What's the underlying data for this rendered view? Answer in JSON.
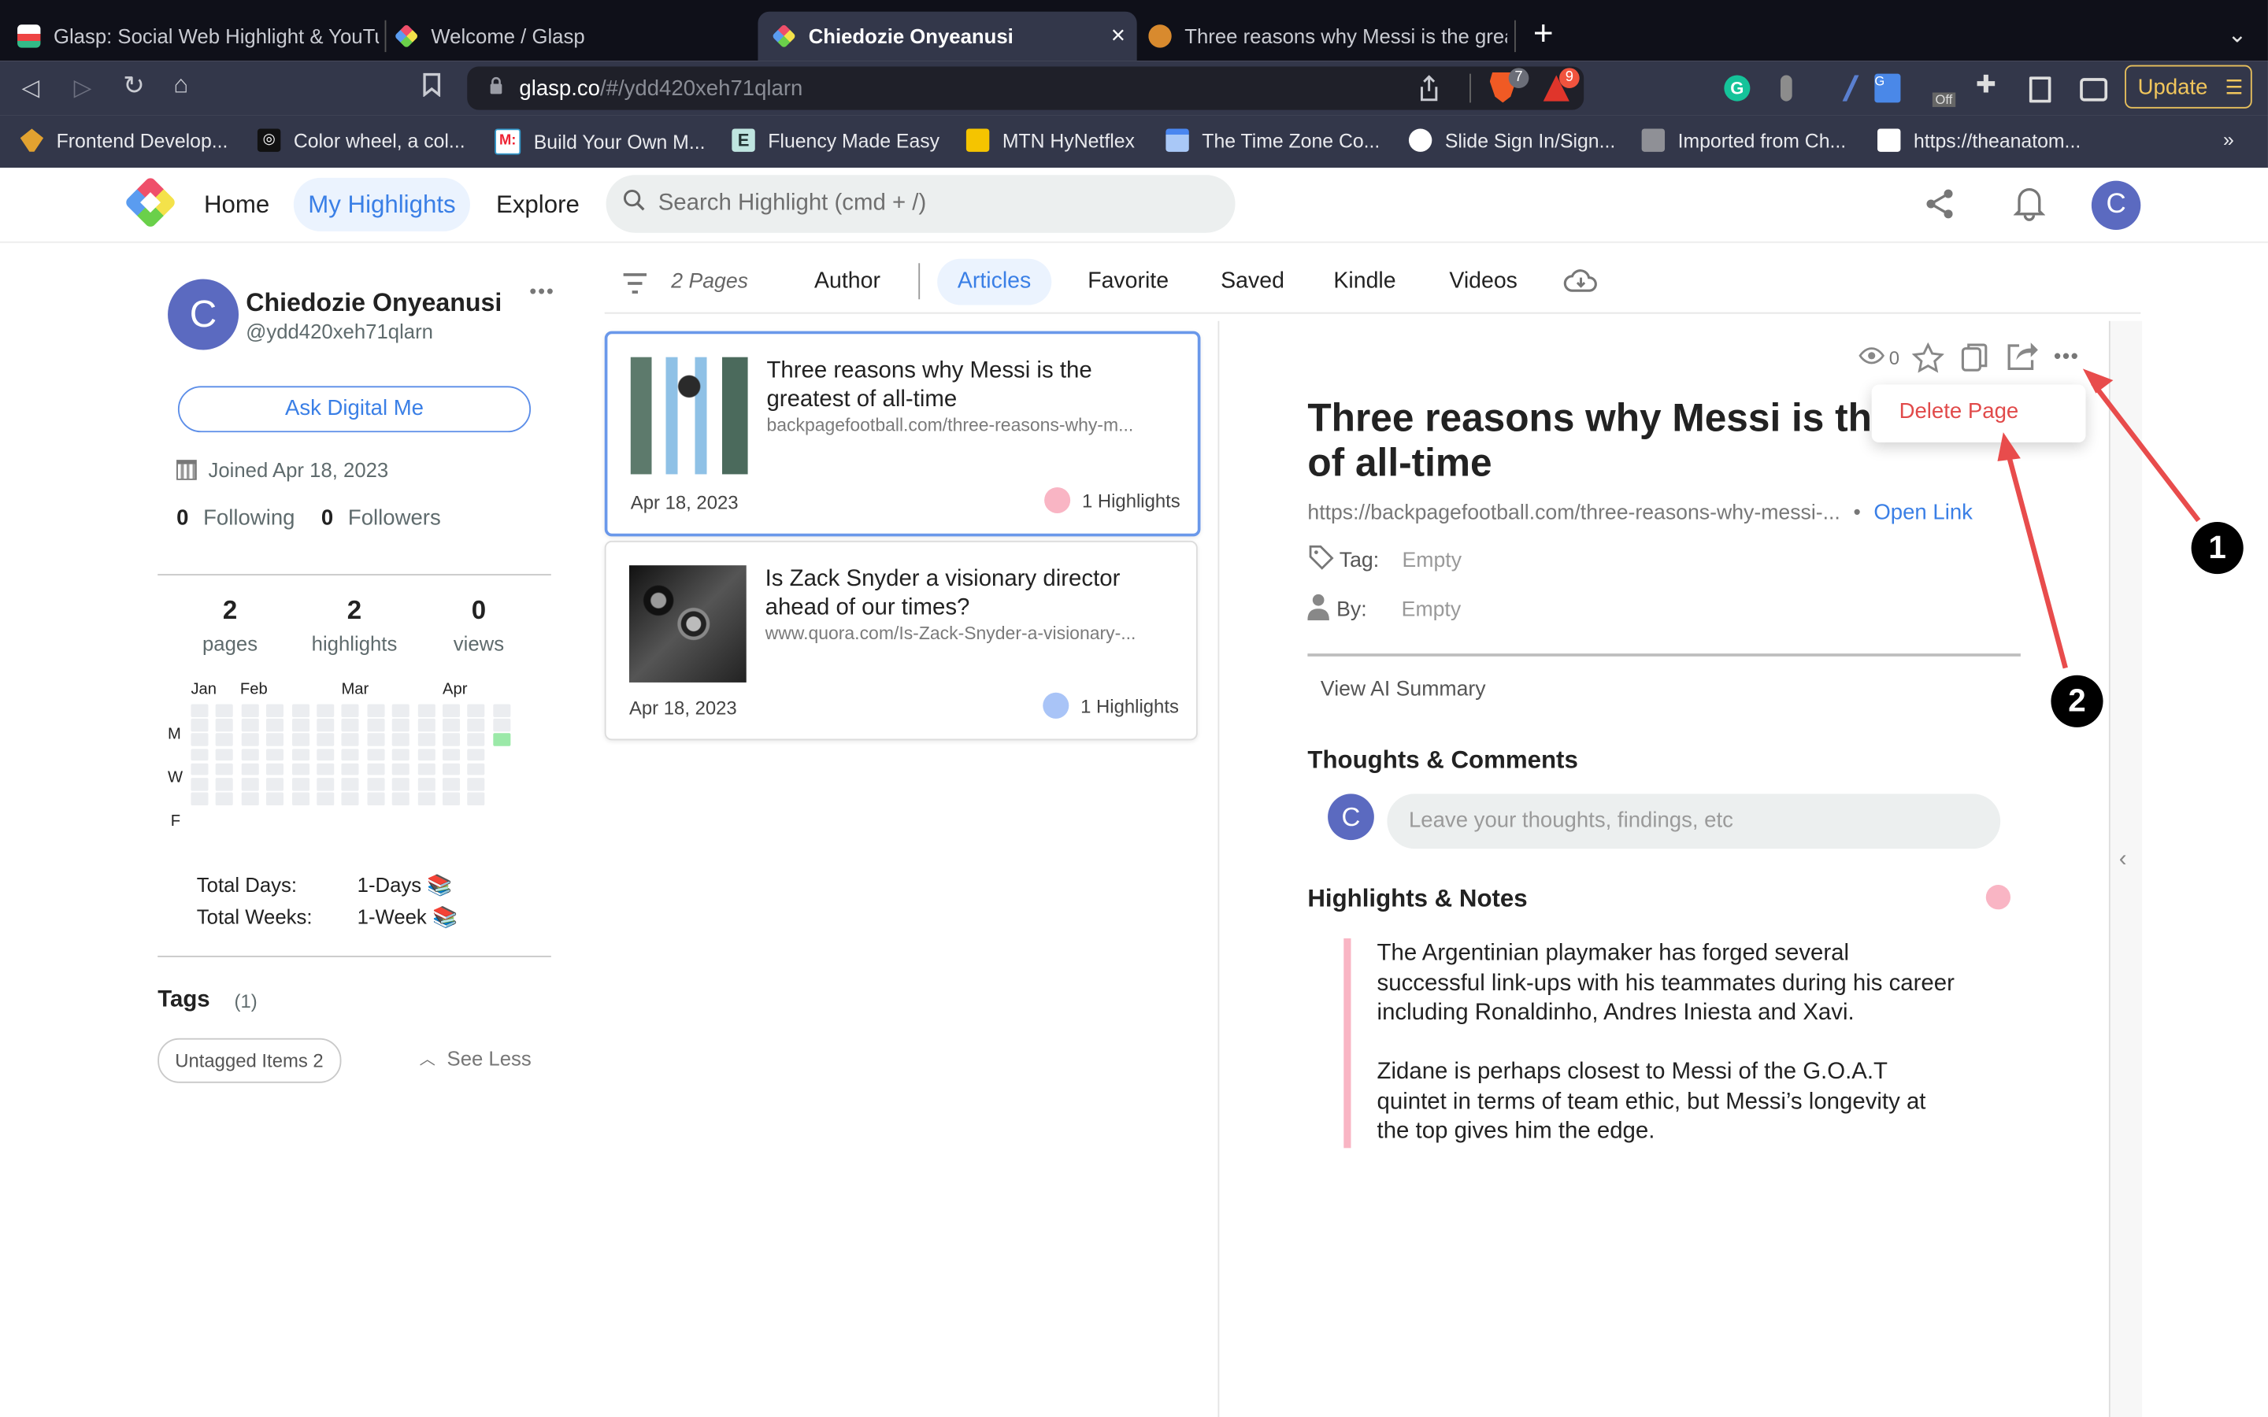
{
  "browser": {
    "tabs": [
      {
        "label": "Glasp: Social Web Highlight & YouTu",
        "active": false
      },
      {
        "label": "Welcome / Glasp",
        "active": false
      },
      {
        "label": "Chiedozie Onyeanusi",
        "active": true
      },
      {
        "label": "Three reasons why Messi is the grea",
        "active": false
      }
    ],
    "new_tab": "+",
    "close_tab": "×",
    "tab_menu": "⌄",
    "url_host": "glasp.co",
    "url_path": "/#/ydd420xeh71qlarn",
    "brave_shield_count": "7",
    "rewards_count": "9",
    "update_label": "Update",
    "bookmarks": [
      "Frontend Develop...",
      "Color wheel, a col...",
      "Build Your Own M...",
      "Fluency Made Easy",
      "MTN HyNetflex",
      "The Time Zone Co...",
      "Slide Sign In/Sign...",
      "Imported from Ch...",
      "https://theanatom..."
    ],
    "bookmarks_overflow": "»"
  },
  "header": {
    "nav": [
      {
        "label": "Home",
        "active": false
      },
      {
        "label": "My Highlights",
        "active": true
      },
      {
        "label": "Explore",
        "active": false
      }
    ],
    "search_placeholder": "Search Highlight (cmd + /)",
    "avatar_initial": "C"
  },
  "profile": {
    "avatar_initial": "C",
    "name": "Chiedozie Onyeanusi",
    "handle": "@ydd420xeh71qlarn",
    "more": "•••",
    "ask_button": "Ask Digital Me",
    "joined": "Joined Apr 18, 2023",
    "following_count": "0",
    "following_label": "Following",
    "followers_count": "0",
    "followers_label": "Followers",
    "stats": [
      {
        "value": "2",
        "label": "pages"
      },
      {
        "value": "2",
        "label": "highlights"
      },
      {
        "value": "0",
        "label": "views"
      }
    ],
    "calendar": {
      "months": [
        "Jan",
        "Feb",
        "Mar",
        "Apr"
      ],
      "weekdays": [
        "M",
        "W",
        "F"
      ],
      "weeks": 13,
      "last_week_days": 3,
      "active_cell": {
        "week": 13,
        "day": 3
      },
      "active_color": "#9be9a8",
      "empty_color": "#ebedf0"
    },
    "total_days_label": "Total Days:",
    "total_days_value": "1-Days",
    "total_weeks_label": "Total Weeks:",
    "total_weeks_value": "1-Week",
    "tags_title": "Tags",
    "tags_count": "(1)",
    "tag_chip": "Untagged Items 2",
    "see_less": "See Less"
  },
  "filter": {
    "pages_count": "2 Pages",
    "tabs": [
      {
        "label": "Author",
        "active": false
      },
      {
        "label": "Articles",
        "active": true
      },
      {
        "label": "Favorite",
        "active": false
      },
      {
        "label": "Saved",
        "active": false
      },
      {
        "label": "Kindle",
        "active": false
      },
      {
        "label": "Videos",
        "active": false
      }
    ]
  },
  "cards": [
    {
      "title": "Three reasons why Messi is the greatest of all-time",
      "url": "backpagefootball.com/three-reasons-why-m...",
      "date": "Apr 18, 2023",
      "highlights": "1 Highlights",
      "dot_color": "#f9b5c4",
      "selected": true
    },
    {
      "title": "Is Zack Snyder a visionary director ahead of our times?",
      "url": "www.quora.com/Is-Zack-Snyder-a-visionary-...",
      "date": "Apr 18, 2023",
      "highlights": "1 Highlights",
      "dot_color": "#a9c4f7",
      "selected": false
    }
  ],
  "detail": {
    "views": "0",
    "title": "Three reasons why Messi is the greatest of all-time",
    "url": "https://backpagefootball.com/three-reasons-why-messi-...",
    "open_link": "Open Link",
    "tag_label": "Tag:",
    "tag_value": "Empty",
    "by_label": "By:",
    "by_value": "Empty",
    "ai_summary": "View AI Summary",
    "comments_title": "Thoughts & Comments",
    "comment_avatar": "C",
    "comment_placeholder": "Leave your thoughts, findings, etc",
    "highlights_title": "Highlights & Notes",
    "highlight_color": "#f9b5c4",
    "highlights": [
      "The Argentinian playmaker has forged several successful link-ups with his teammates during his career including Ronaldinho, Andres Iniesta and Xavi.",
      "Zidane is perhaps closest to Messi of the G.O.A.T quintet in terms of team ethic, but Messi’s longevity at the top gives him the edge."
    ],
    "menu_item": "Delete Page"
  },
  "annotations": [
    {
      "label": "1"
    },
    {
      "label": "2"
    }
  ],
  "colors": {
    "accent": "#3a7fe6",
    "avatar": "#5b6ac0",
    "danger": "#e14a4a",
    "annotation_arrow": "#e84c4c"
  }
}
